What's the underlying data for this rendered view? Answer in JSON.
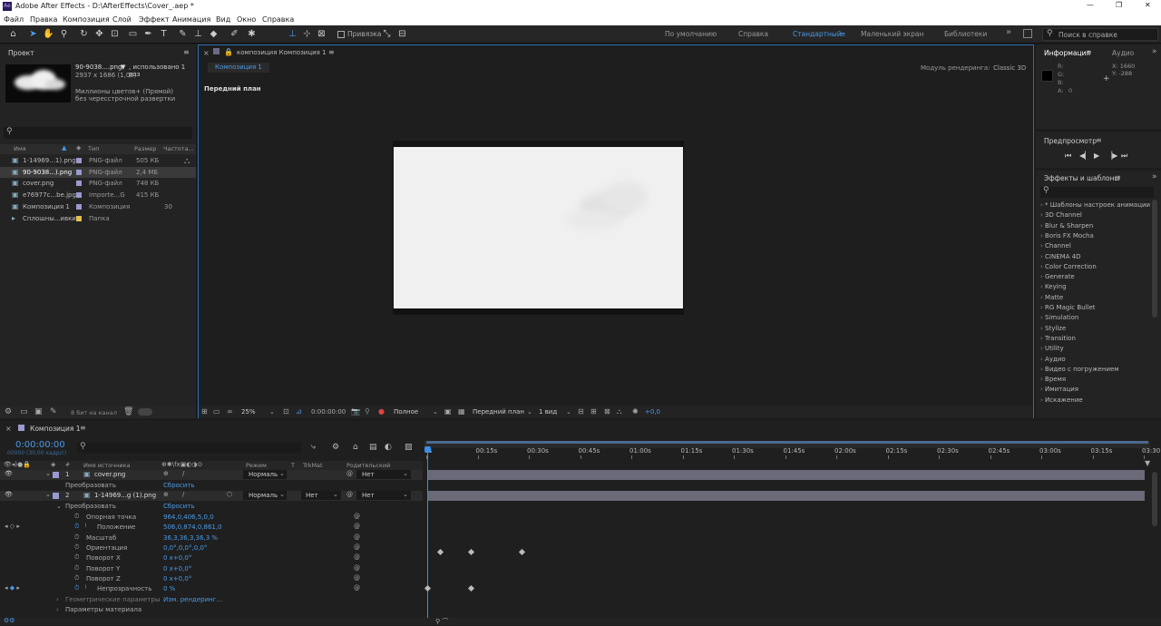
{
  "window": {
    "app_title": "Adobe After Effects - D:\\AfterEffects\\Cover_.aep *",
    "minimize": "—",
    "maximize": "❐",
    "close": "✕"
  },
  "menu": [
    "Файл",
    "Правка",
    "Композиция",
    "Слой",
    "Эффект",
    "Анимация",
    "Вид",
    "Окно",
    "Справка"
  ],
  "toolbar": {
    "snap_label": "Привязка",
    "workspaces": [
      "По умолчанию",
      "Справка",
      "Стандартный",
      "Маленький экран",
      "Библиотеки"
    ],
    "active_workspace": "Стандартный",
    "search_placeholder": "Поиск в справке"
  },
  "project": {
    "tab": "Проект",
    "selected_name": "90-9038....png",
    "selected_usage": ", использовано 1 раз",
    "selected_dims": "2937 x 1686 (1,00)",
    "selected_color": "Миллионы цветов+ (Прямой)",
    "selected_interlace": "без чересстрочной развертки",
    "columns": [
      "Имя",
      "Тип",
      "Размер",
      "Частота..."
    ],
    "items": [
      {
        "name": "1-14969...1).png",
        "type": "PNG-файл",
        "size": "505 КБ",
        "rate": "",
        "swatch": "#9a9ad0"
      },
      {
        "name": "90-9038...).png",
        "type": "PNG-файл",
        "size": "2,4 МБ",
        "rate": "",
        "swatch": "#9a9ad0"
      },
      {
        "name": "cover.png",
        "type": "PNG-файл",
        "size": "748 КБ",
        "rate": "",
        "swatch": "#9a9ad0"
      },
      {
        "name": "e76977c...be.jpg",
        "type": "Importe...G",
        "size": "415 КБ",
        "rate": "",
        "swatch": "#9a9ad0"
      },
      {
        "name": "Композиция 1",
        "type": "Композиция",
        "size": "",
        "rate": "30",
        "swatch": "#9a9ad0"
      },
      {
        "name": "Сплошны...ивки",
        "type": "Папка",
        "size": "",
        "rate": "",
        "swatch": "#e0c050"
      }
    ],
    "bpc": "8 бит на канал"
  },
  "composition": {
    "panel_tab": "композиция Композиция 1",
    "comp_tab": "Композиция 1",
    "renderer_label": "Модуль рендеринга:",
    "renderer": "Classic 3D",
    "view_label": "Передний план",
    "zoom": "25%",
    "timecode": "0:00:00:00",
    "resolution": "Полное",
    "camera": "Передний план",
    "views": "1 вид",
    "exposure": "+0,0"
  },
  "info": {
    "tab": "Информация",
    "tab2": "Аудио",
    "r": "R:",
    "g": "G:",
    "b": "B:",
    "a": "A:",
    "a_val": "0",
    "x": "X: 1660",
    "y": "Y: -288"
  },
  "preview": {
    "tab": "Предпросмотр"
  },
  "effects": {
    "tab": "Эффекты и шаблоны",
    "categories": [
      "* Шаблоны настроек анимации",
      "3D Channel",
      "Blur & Sharpen",
      "Boris FX Mocha",
      "Channel",
      "CINEMA 4D",
      "Color Correction",
      "Generate",
      "Keying",
      "Matte",
      "RG Magic Bullet",
      "Simulation",
      "Stylize",
      "Transition",
      "Utility",
      "Аудио",
      "Видео с погружением",
      "Время",
      "Имитация",
      "Искажение"
    ]
  },
  "timeline": {
    "tab": "Композиция 1",
    "timecode": "0:00:00:00",
    "fps": "00000 (30,00 кадр/с)",
    "col_source": "Имя источника",
    "col_mode": "Режим",
    "col_t": "T",
    "col_trkmat": "TrkMat",
    "col_parent": "Родительский элемент...",
    "ruler": [
      "0s",
      "00:15s",
      "00:30s",
      "00:45s",
      "01:00s",
      "01:15s",
      "01:30s",
      "01:45s",
      "02:00s",
      "02:15s",
      "02:30s",
      "02:45s",
      "03:00s",
      "03:15s",
      "03:30"
    ],
    "layers": [
      {
        "num": "1",
        "name": "cover.png",
        "mode": "Нормаль",
        "trkmat": "",
        "parent": "Нет"
      },
      {
        "num": "2",
        "name": "1-14969...g (1).png",
        "mode": "Нормаль",
        "trkmat": "Нет",
        "parent": "Нет"
      }
    ],
    "transform_label": "Преобразовать",
    "reset_label": "Сбросить",
    "props": [
      {
        "name": "Опорная точка",
        "value": "964,0,406,5,0,0"
      },
      {
        "name": "Положение",
        "value": "506,0,874,0,861,0"
      },
      {
        "name": "Масштаб",
        "value": "36,3,36,3,36,3 %"
      },
      {
        "name": "Ориентация",
        "value": "0,0°,0,0°,0,0°"
      },
      {
        "name": "Поворот X",
        "value": "0 x+0,0°"
      },
      {
        "name": "Поворот Y",
        "value": "0 x+0,0°"
      },
      {
        "name": "Поворот Z",
        "value": "0 x+0,0°"
      },
      {
        "name": "Непрозрачность",
        "value": "0 %"
      }
    ],
    "geometry_label": "Геометрические параметры",
    "geometry_value": "Изм. рендеринг...",
    "material_label": "Параметры материала"
  }
}
